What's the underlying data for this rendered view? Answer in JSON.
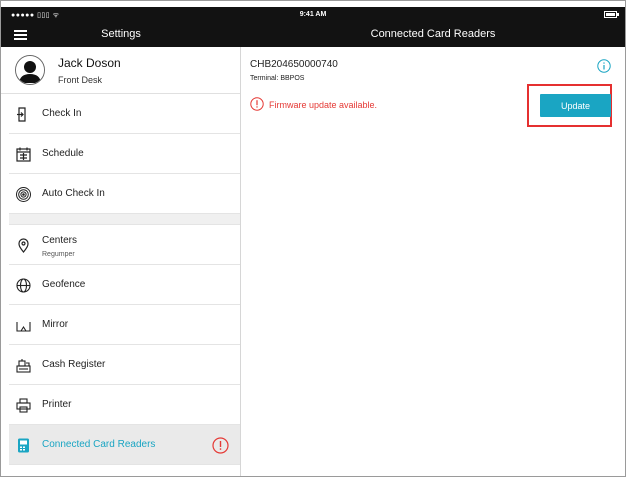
{
  "status_bar": {
    "carrier": "●●●●● ▯▯▯ ᯤ",
    "time": "9:41 AM"
  },
  "nav": {
    "left_title": "Settings",
    "right_title": "Connected Card Readers"
  },
  "profile": {
    "name": "Jack Doson",
    "role": "Front Desk"
  },
  "sidebar": {
    "items": [
      {
        "label": "Check In",
        "icon": "check-in-icon"
      },
      {
        "label": "Schedule",
        "icon": "calendar-icon"
      },
      {
        "label": "Auto Check In",
        "icon": "fingerprint-icon"
      },
      {
        "label": "Centers",
        "sublabel": "Regumper",
        "icon": "location-pin-icon"
      },
      {
        "label": "Geofence",
        "icon": "globe-icon"
      },
      {
        "label": "Mirror",
        "icon": "mirror-icon"
      },
      {
        "label": "Cash Register",
        "icon": "cash-register-icon"
      },
      {
        "label": "Printer",
        "icon": "printer-icon"
      },
      {
        "label": "Connected Card Readers",
        "icon": "card-reader-icon",
        "active": true,
        "alert": true
      }
    ]
  },
  "reader": {
    "serial": "CHB204650000740",
    "terminal": "Terminal: BBPOS",
    "firmware_message": "Firmware update available.",
    "update_label": "Update"
  },
  "colors": {
    "accent": "#1aa5c3",
    "alert": "#e53935",
    "highlight": "#e53030",
    "bar": "#121212"
  }
}
